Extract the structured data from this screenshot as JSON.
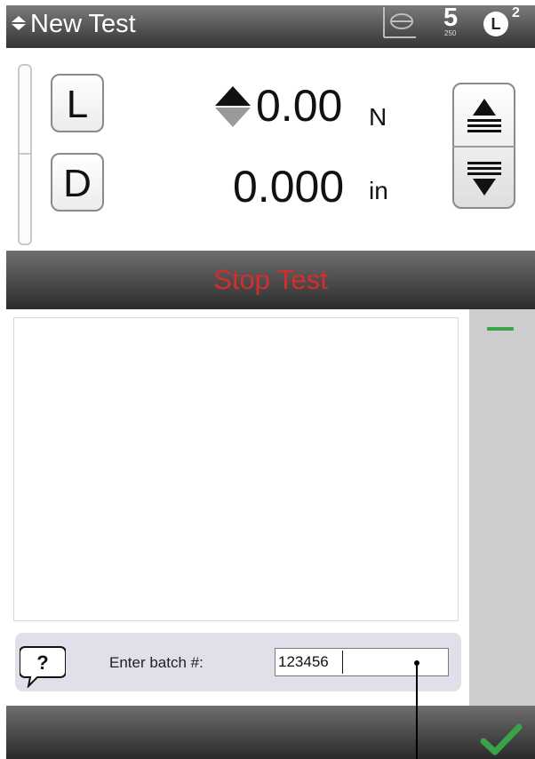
{
  "titlebar": {
    "title": "New Test",
    "speed_digit": "5",
    "speed_sub": "250",
    "clock_letter": "L",
    "clock_sup": "2"
  },
  "readouts": {
    "load_key": "L",
    "distance_key": "D",
    "load_value": "0.00",
    "load_unit": "N",
    "distance_value": "0.000",
    "distance_unit": "in"
  },
  "stop_bar": {
    "label": "Stop Test",
    "color": "#d72c2c"
  },
  "prompt": {
    "label": "Enter batch #:",
    "value": "123456"
  },
  "icons": {
    "title": "updown-arrow-icon",
    "graph": "graph-axis-icon",
    "speed": "speed-icon",
    "clock": "clock-icon",
    "jog_up": "jog-up-icon",
    "jog_down": "jog-down-icon",
    "help": "help-icon",
    "confirm": "checkmark-icon"
  },
  "colors": {
    "accent_green": "#3aa34a"
  }
}
